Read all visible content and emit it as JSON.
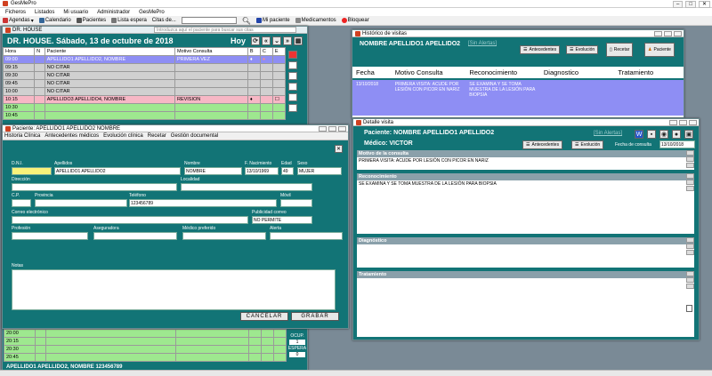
{
  "app": {
    "title": "GesMePro"
  },
  "menu": [
    "Ficheros",
    "Listados",
    "Mi usuario",
    "Administrador",
    "GesMePro"
  ],
  "toolbar": {
    "agendas": "Agendas",
    "calendario": "Calendario",
    "pacientes": "Pacientes",
    "lista_espera": "Lista espera",
    "citas_de": "Citas de...",
    "mi_paciente": "Mi paciente",
    "medicamentos": "Medicamentos",
    "bloquear": "Bloquear",
    "hint": "Introduzca aquí el paciente para buscar sus citas"
  },
  "agenda": {
    "window_title": "DR. HOUSE",
    "header": "DR. HOUSE. Sábado, 13 de octubre de 2018",
    "today": "Hoy",
    "columns": [
      "Hora",
      "N",
      "Paciente",
      "Motivo Consulta",
      "B",
      "C",
      "E"
    ],
    "rows": [
      {
        "time": "09:00",
        "patient": "APELLIDO1 APELLIDO2, NOMBRE",
        "motive": "PRIMERA VEZ",
        "style": "sel"
      },
      {
        "time": "09:15",
        "patient": "NO CITAR",
        "motive": "",
        "style": "gray"
      },
      {
        "time": "09:30",
        "patient": "NO CITAR",
        "motive": "",
        "style": "gray"
      },
      {
        "time": "09:45",
        "patient": "NO CITAR",
        "motive": "",
        "style": "gray"
      },
      {
        "time": "10:00",
        "patient": "NO CITAR",
        "motive": "",
        "style": "gray"
      },
      {
        "time": "10:15",
        "patient": "APELLIDO3 APELLIDO4, NOMBRE",
        "motive": "REVISION",
        "style": "pink"
      },
      {
        "time": "10:30",
        "patient": "",
        "motive": "",
        "style": "green"
      },
      {
        "time": "10:45",
        "patient": "",
        "motive": "",
        "style": "green"
      }
    ],
    "bottom_rows": [
      {
        "time": "20:00"
      },
      {
        "time": "20:15"
      },
      {
        "time": "20:30"
      },
      {
        "time": "20:45"
      }
    ],
    "ocup_label": "OCUP.",
    "ocup_value": "1",
    "espera_label": "ESPERA",
    "espera_value": "0",
    "footer": "APELLIDO1 APELLIDO2, NOMBRE 123456789"
  },
  "patient": {
    "window_title": "Paciente: APELLIDO1 APELLIDO2 NOMBRE",
    "tabs": [
      "Historia Clínica",
      "Antecedentes médicos",
      "Evolución clínica",
      "Recetar",
      "Gestión documental"
    ],
    "labels": {
      "dni": "D.N.I.",
      "apellidos": "Apellidos",
      "nombre": "Nombre",
      "f_nac": "F. Nacimiento",
      "edad": "Edad",
      "sexo": "Sexo",
      "direccion": "Dirección",
      "localidad": "Localidad",
      "cp": "C.P.",
      "provincia": "Provincia",
      "telefono": "Teléfono",
      "movil": "Móvil",
      "correo": "Correo electrónico",
      "publicidad": "Publicidad correo",
      "profesion": "Profesión",
      "aseguradora": "Aseguradora",
      "medico_pref": "Médico preferido",
      "alerta": "Alerta",
      "notas": "Notas"
    },
    "values": {
      "dni": "",
      "apellidos": "APELLIDO1 APELLIDO2",
      "nombre": "NOMBRE",
      "f_nac": "13/10/1969",
      "edad": "49",
      "sexo": "MUJER",
      "telefono": "123456789",
      "publicidad": "NO PERMITE"
    },
    "cancel": "CANCELAR",
    "save": "GRABAR"
  },
  "historico": {
    "window_title": "Histórico de visitas",
    "name": "NOMBRE APELLIDO1 APELLIDO2",
    "alert": "[Sin Alertas]",
    "btn_antecedentes": "Antecedentes",
    "btn_evolucion": "Evolución",
    "btn_recetar": "Recetar",
    "btn_paciente": "Paciente",
    "columns": [
      "Fecha",
      "Motivo Consulta",
      "Reconocimiento",
      "Diagnostico",
      "Tratamiento"
    ],
    "row": {
      "fecha": "13/10/2018",
      "motivo": "PRIMERA VISITA: ACUDE POR LESIÓN CON PICOR EN NARIZ",
      "reconocimiento": "SE EXAMINA Y SE TOMA MUESTRA DE LA LESIÓN PARA BIOPSIA",
      "diagnostico": "",
      "tratamiento": ""
    }
  },
  "detalle": {
    "window_title": "Detalle visita",
    "paciente": "Paciente: NOMBRE APELLIDO1 APELLIDO2",
    "alert": "[Sin Alertas]",
    "medico": "Médico: VICTOR",
    "btn_antecedentes": "Antecedentes",
    "btn_evolucion": "Evolución",
    "fecha_label": "Fecha de consulta",
    "fecha": "13/10/2018",
    "motivo_label": "Motivo de la consulta",
    "motivo": "PRIMERA VISITA: ACUDE POR LESIÓN CON PICOR EN NARIZ",
    "recon_label": "Reconocimiento",
    "recon": "SE EXAMINA Y SE TOMA MUESTRA DE LA LESIÓN PARA BIOPSIA",
    "diag_label": "Diagnóstico",
    "diag": "",
    "trat_label": "Tratamiento",
    "trat": ""
  },
  "colors": {
    "teal": "#127476",
    "selected": "#8e8ef4",
    "pink": "#f7b7c5",
    "green": "#9ee88f"
  }
}
